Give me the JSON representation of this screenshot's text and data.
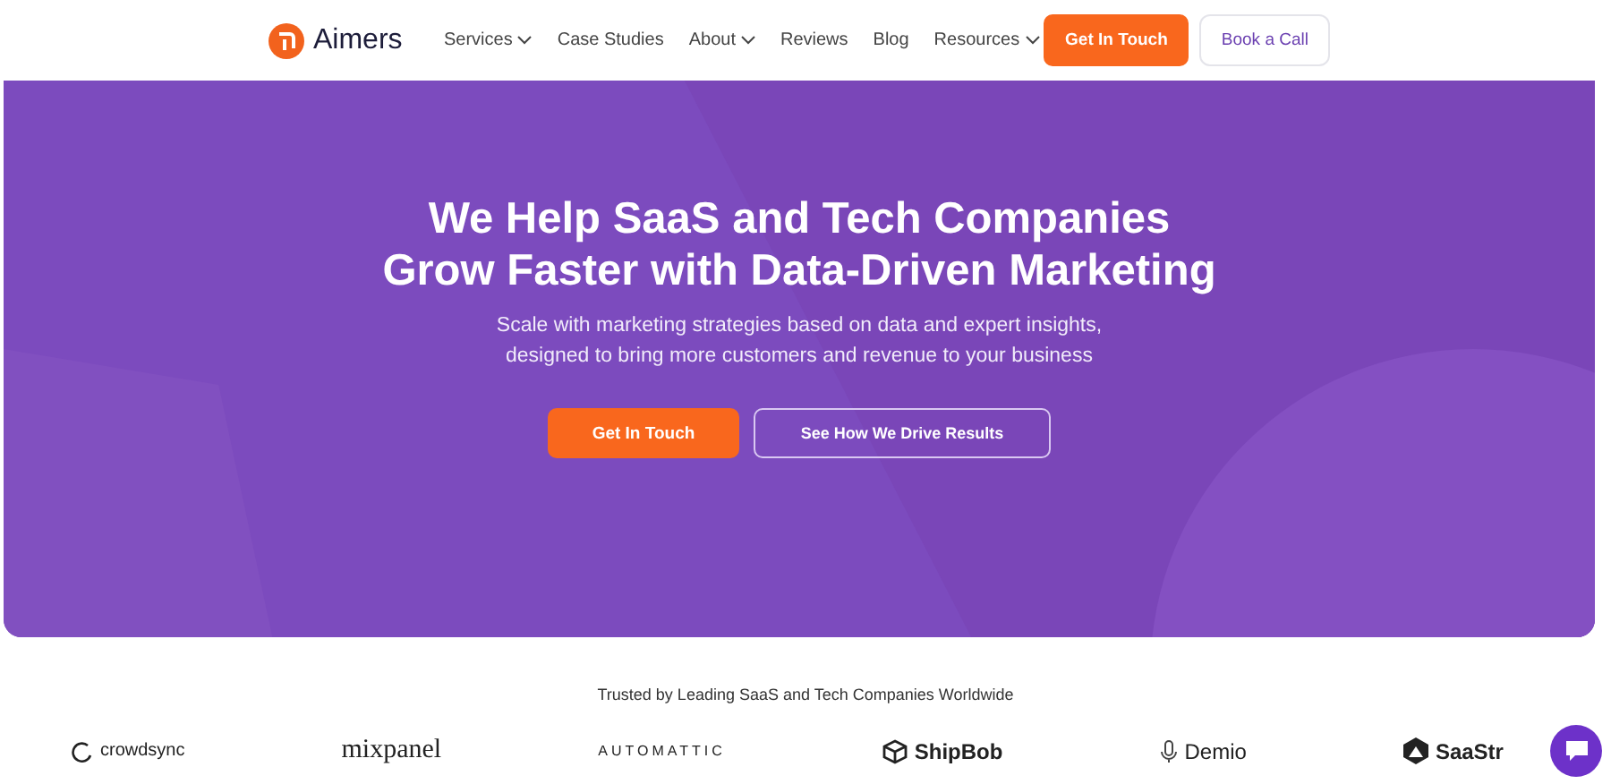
{
  "header": {
    "brand": "Aimers",
    "nav": [
      {
        "label": "Services",
        "has_menu": true
      },
      {
        "label": "Case Studies",
        "has_menu": false
      },
      {
        "label": "About",
        "has_menu": true
      },
      {
        "label": "Reviews",
        "has_menu": false
      },
      {
        "label": "Blog",
        "has_menu": false
      },
      {
        "label": "Resources",
        "has_menu": true
      }
    ],
    "primary_button": "Get In Touch",
    "secondary_button": "Book a Call"
  },
  "hero": {
    "title_lines": [
      "We Help SaaS and Tech Companies",
      "Grow Faster with Data-Driven Marketing"
    ],
    "subtitle_lines": [
      "Scale with marketing strategies based on data and expert insights,",
      "designed to bring more customers and revenue to your business"
    ],
    "primary_button": "Get In Touch",
    "secondary_button": "See How We Drive Results"
  },
  "clients": {
    "heading": "Trusted by Leading SaaS and Tech Companies Worldwide",
    "logos": [
      {
        "name": "crowdsync",
        "kind": "ring"
      },
      {
        "name": "mixpanel",
        "kind": "serif"
      },
      {
        "name": "AUTOMATTIC",
        "kind": "spaced"
      },
      {
        "name": "ShipBob",
        "kind": "box"
      },
      {
        "name": "Demio",
        "kind": "mic"
      },
      {
        "name": "SaaStr",
        "kind": "mountain"
      }
    ]
  }
}
